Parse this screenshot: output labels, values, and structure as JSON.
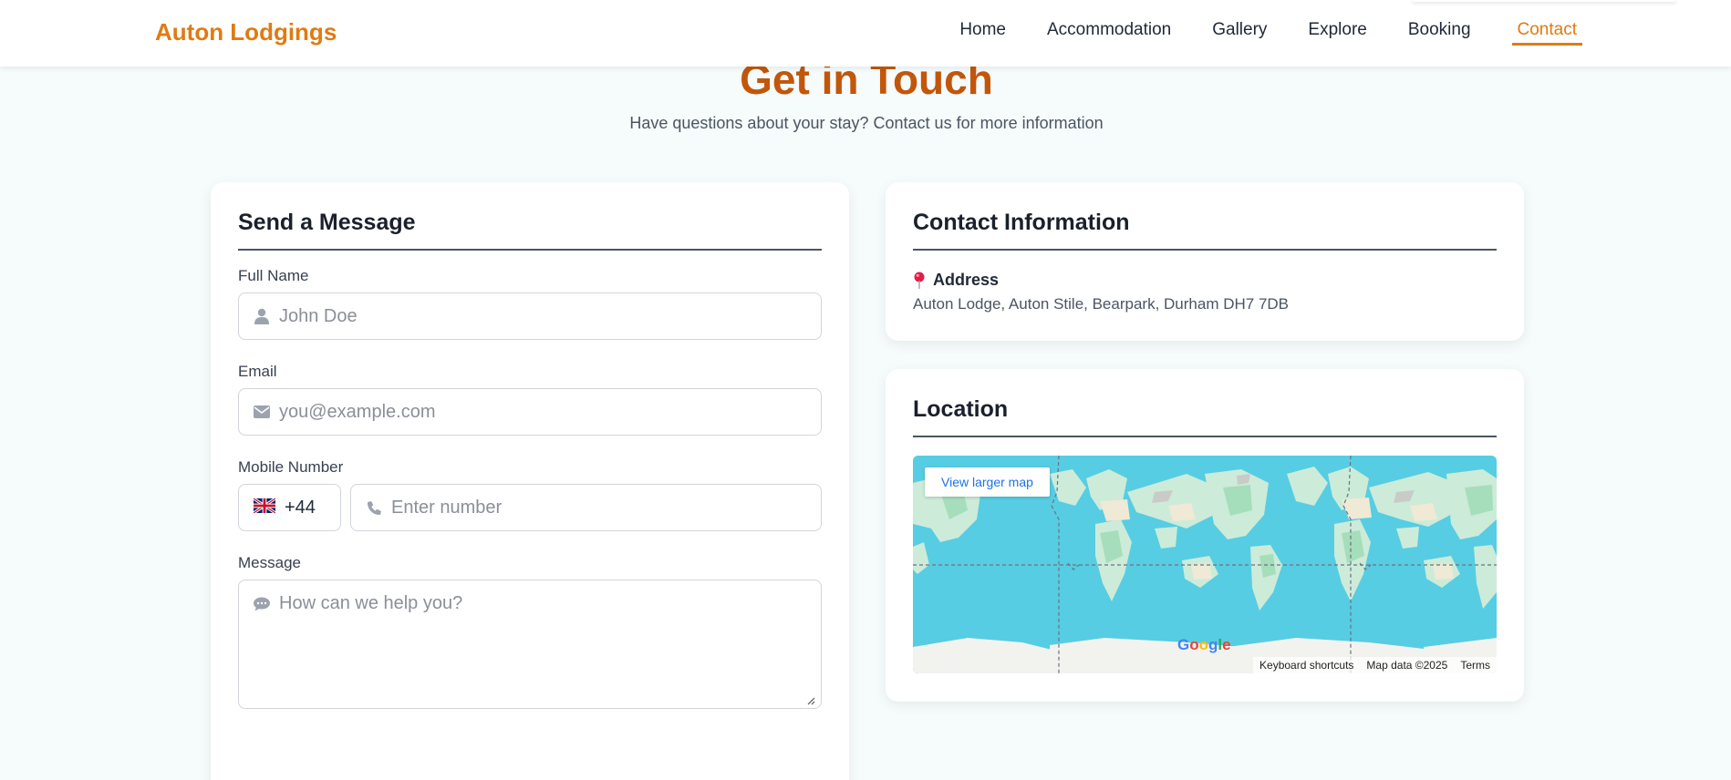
{
  "nav": {
    "brand": "Auton Lodgings",
    "links": [
      "Home",
      "Accommodation",
      "Gallery",
      "Explore",
      "Booking",
      "Contact"
    ],
    "active": "Contact"
  },
  "hero": {
    "title": "Get in Touch",
    "subtitle": "Have questions about your stay? Contact us for more information"
  },
  "form": {
    "title": "Send a Message",
    "name_label": "Full Name",
    "name_placeholder": "John Doe",
    "email_label": "Email",
    "email_placeholder": "you@example.com",
    "mobile_label": "Mobile Number",
    "country_code": "+44",
    "country_flag": "uk-flag-icon",
    "number_placeholder": "Enter number",
    "message_label": "Message",
    "message_placeholder": "How can we help you?"
  },
  "contact": {
    "title": "Contact Information",
    "address_label": "Address",
    "address": "Auton Lodge, Auton Stile, Bearpark, Durham DH7 7DB"
  },
  "location": {
    "title": "Location",
    "view_larger": "View larger map",
    "logo": "Google",
    "footer": [
      "Keyboard shortcuts",
      "Map data ©2025",
      "Terms"
    ]
  },
  "colors": {
    "brand": "#e07b12",
    "title": "#c2560b",
    "water": "#56cde2",
    "land": "#cdebd9"
  }
}
